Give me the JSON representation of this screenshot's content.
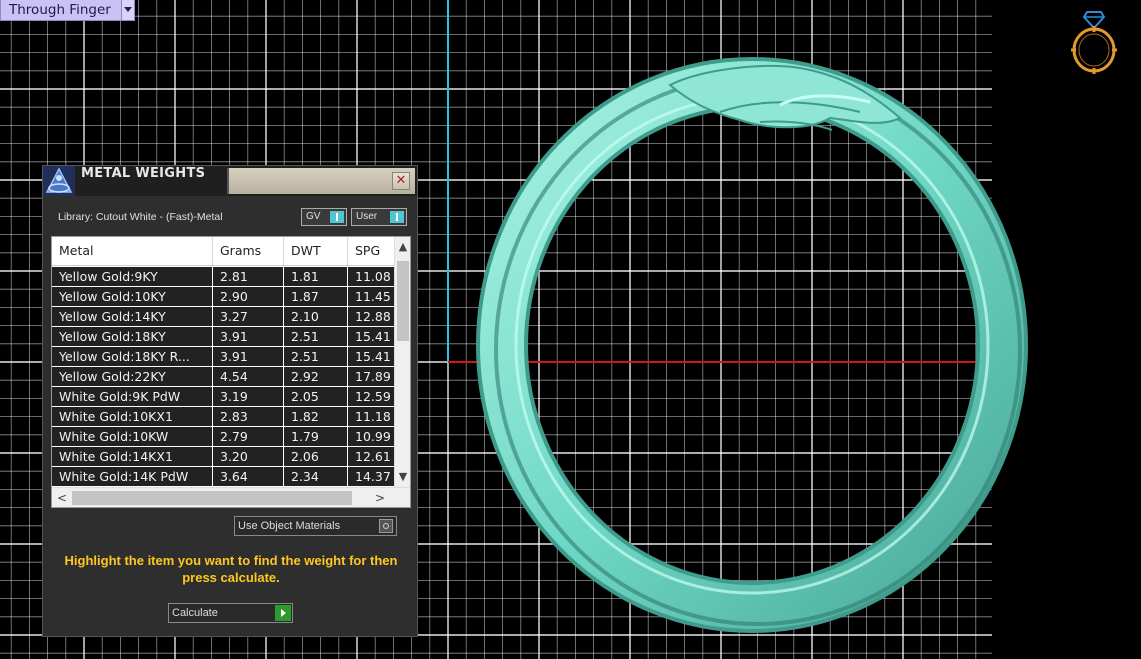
{
  "view_dropdown": {
    "label": "Through Finger"
  },
  "panel": {
    "title": "METAL WEIGHTS",
    "library_label": "Library: Cutout White - (Fast)-Metal",
    "toggles": [
      {
        "label": "GV"
      },
      {
        "label": "User"
      }
    ],
    "columns": [
      "Metal",
      "Grams",
      "DWT",
      "SPG"
    ],
    "rows": [
      [
        "Yellow Gold:9KY",
        "2.81",
        "1.81",
        "11.08"
      ],
      [
        "Yellow Gold:10KY",
        "2.90",
        "1.87",
        "11.45"
      ],
      [
        "Yellow Gold:14KY",
        "3.27",
        "2.10",
        "12.88"
      ],
      [
        "Yellow Gold:18KY",
        "3.91",
        "2.51",
        "15.41"
      ],
      [
        "Yellow Gold:18KY R...",
        "3.91",
        "2.51",
        "15.41"
      ],
      [
        "Yellow Gold:22KY",
        "4.54",
        "2.92",
        "17.89"
      ],
      [
        "White Gold:9K PdW",
        "3.19",
        "2.05",
        "12.59"
      ],
      [
        "White Gold:10KX1",
        "2.83",
        "1.82",
        "11.18"
      ],
      [
        "White Gold:10KW",
        "2.79",
        "1.79",
        "10.99"
      ],
      [
        "White Gold:14KX1",
        "3.20",
        "2.06",
        "12.61"
      ],
      [
        "White Gold:14K PdW",
        "3.64",
        "2.34",
        "14.37"
      ]
    ],
    "use_object_materials_label": "Use Object Materials",
    "instruction": "Highlight the item you want to find the weight for then press calculate.",
    "calculate_label": "Calculate"
  },
  "colors": {
    "ring": "#7fe0cc",
    "grid": "#ffffff",
    "axis_red": "#d01818",
    "axis_cyan": "#22c8e0",
    "instruction_text": "#ffc820",
    "ring_icon": "#e09a30"
  }
}
